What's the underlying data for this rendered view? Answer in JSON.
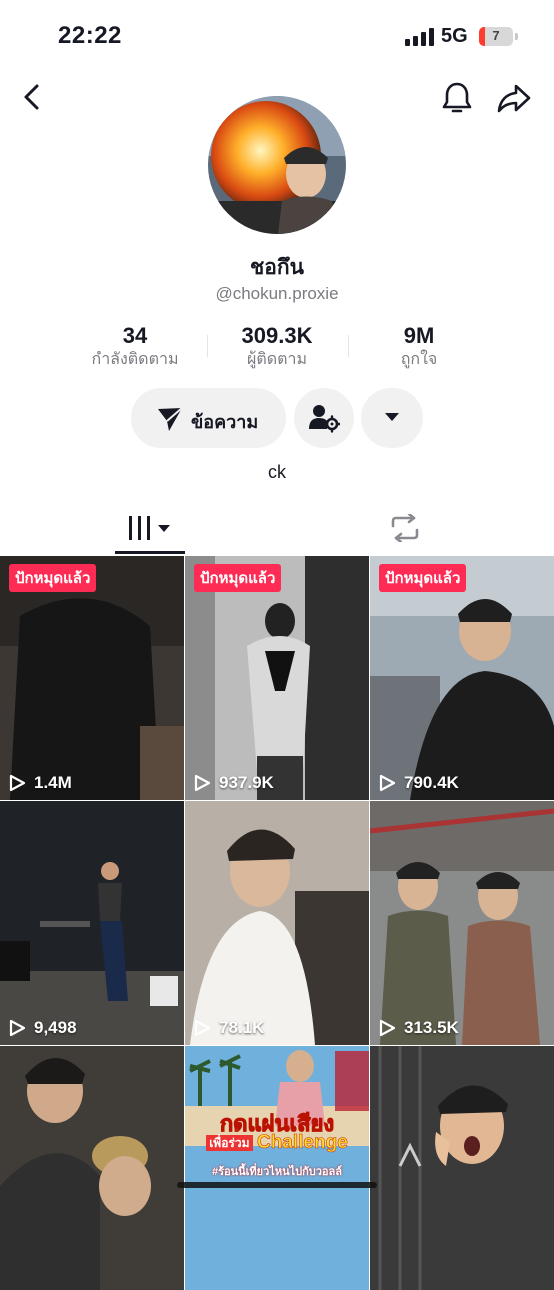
{
  "status_bar": {
    "time": "22:22",
    "network": "5G",
    "battery": "7",
    "battery_level_percent": 7
  },
  "header": {
    "back_icon": "chevron-left-icon",
    "bell_icon": "bell-icon",
    "share_icon": "share-arrow-icon"
  },
  "profile": {
    "display_name": "ชอกึน",
    "username": "@chokun.proxie",
    "bio": "ck"
  },
  "stats": [
    {
      "value": "34",
      "label": "กำลังติดตาม"
    },
    {
      "value": "309.3K",
      "label": "ผู้ติดตาม"
    },
    {
      "value": "9M",
      "label": "ถูกใจ"
    }
  ],
  "actions": {
    "message_label": "ข้อความ",
    "message_icon": "send-icon",
    "follow_icon": "user-settings-icon",
    "more_icon": "caret-down-icon"
  },
  "tabs": {
    "videos_icon": "grid-columns-icon",
    "reposts_icon": "repost-icon"
  },
  "colors": {
    "accent_pin": "#fe2c55",
    "text_primary": "#161823",
    "text_secondary": "#7a7b80",
    "button_bg": "#f1f1f2"
  },
  "videos": [
    {
      "pinned_label": "ปักหมุดแล้ว",
      "views": "1.4M"
    },
    {
      "pinned_label": "ปักหมุดแล้ว",
      "views": "937.9K"
    },
    {
      "pinned_label": "ปักหมุดแล้ว",
      "views": "790.4K"
    },
    {
      "views": "9,498"
    },
    {
      "views": "78.1K"
    },
    {
      "views": "313.5K"
    },
    {},
    {
      "overlay_title": "กดแผ่นเสียง",
      "overlay_sub_prefix": "เพื่อร่วม",
      "overlay_sub_word": "Challenge",
      "overlay_tag": "#ร้อนนี้เที่ยวไหนไปกับวอลล์"
    },
    {}
  ]
}
